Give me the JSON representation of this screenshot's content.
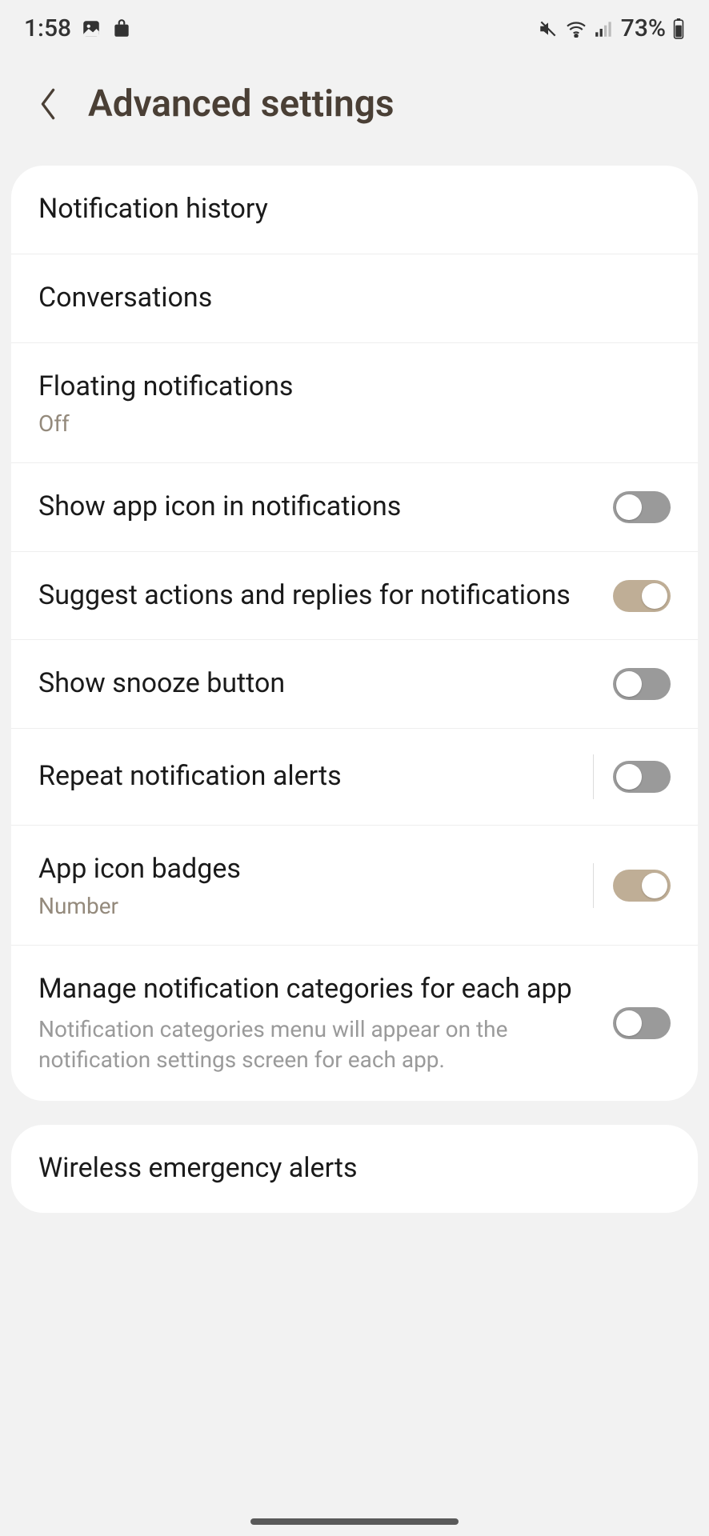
{
  "status": {
    "time": "1:58",
    "battery": "73%"
  },
  "header": {
    "title": "Advanced settings"
  },
  "card1": {
    "notification_history": "Notification history",
    "conversations": "Conversations",
    "floating_notifications": "Floating notifications",
    "floating_notifications_sub": "Off",
    "show_app_icon": "Show app icon in notifications",
    "show_app_icon_on": false,
    "suggest_actions": "Suggest actions and replies for notifications",
    "suggest_actions_on": true,
    "show_snooze": "Show snooze button",
    "show_snooze_on": false,
    "repeat_alerts": "Repeat notification alerts",
    "repeat_alerts_on": false,
    "app_icon_badges": "App icon badges",
    "app_icon_badges_sub": "Number",
    "app_icon_badges_on": true,
    "manage_categories": "Manage notification categories for each app",
    "manage_categories_desc": "Notification categories menu will appear on the notification settings screen for each app.",
    "manage_categories_on": false
  },
  "card2": {
    "wireless_emergency": "Wireless emergency alerts"
  }
}
